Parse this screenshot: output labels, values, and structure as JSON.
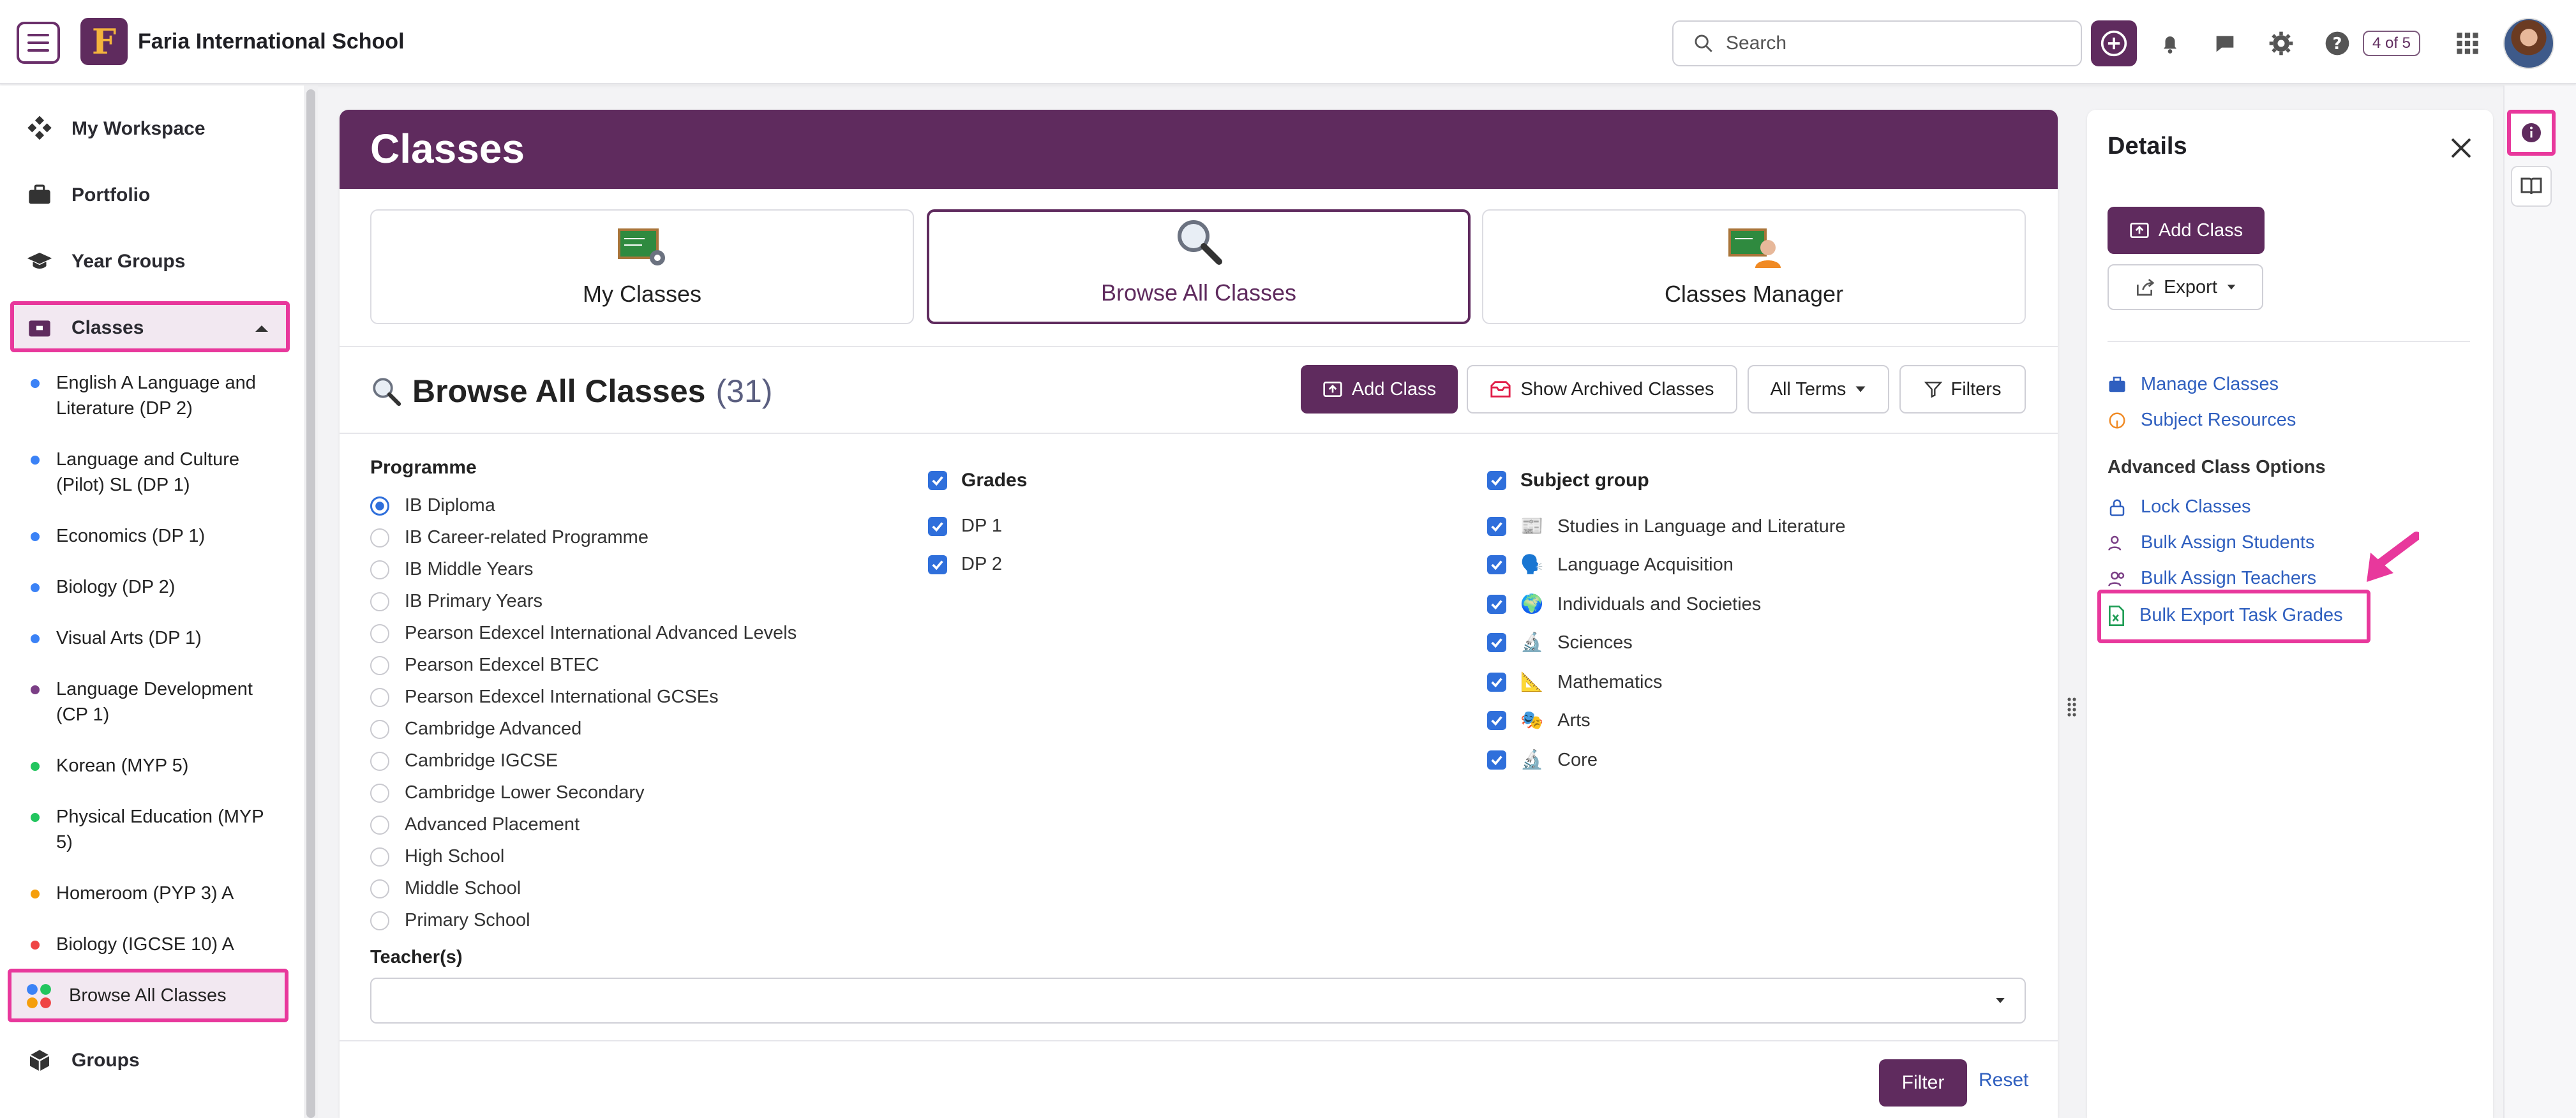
{
  "header": {
    "school_name": "Faria International School",
    "logo_letter": "F",
    "search_placeholder": "Search",
    "progress_badge": "4 of 5"
  },
  "sidebar": {
    "nav": [
      {
        "label": "My Workspace",
        "icon": "workspace-icon"
      },
      {
        "label": "Portfolio",
        "icon": "portfolio-icon"
      },
      {
        "label": "Year Groups",
        "icon": "graduation-cap-icon"
      },
      {
        "label": "Classes",
        "icon": "classes-icon"
      }
    ],
    "class_items": [
      {
        "label": "English A Language and Literature (DP 2)",
        "color": "#3b82f6"
      },
      {
        "label": "Language and Culture (Pilot) SL (DP 1)",
        "color": "#3b82f6"
      },
      {
        "label": "Economics (DP 1)",
        "color": "#3b82f6"
      },
      {
        "label": "Biology (DP 2)",
        "color": "#3b82f6"
      },
      {
        "label": "Visual Arts (DP 1)",
        "color": "#3b82f6"
      },
      {
        "label": "Language Development (CP 1)",
        "color": "#7b3f86"
      },
      {
        "label": "Korean (MYP 5)",
        "color": "#22c55e"
      },
      {
        "label": "Physical Education (MYP 5)",
        "color": "#22c55e"
      },
      {
        "label": "Homeroom (PYP 3) A",
        "color": "#f59e0b"
      },
      {
        "label": "Biology (IGCSE 10) A",
        "color": "#ef4444"
      }
    ],
    "browse_all": "Browse All Classes",
    "groups": "Groups"
  },
  "main": {
    "title": "Classes",
    "cards": [
      {
        "label": "My Classes"
      },
      {
        "label": "Browse All Classes"
      },
      {
        "label": "Classes Manager"
      }
    ],
    "browse_title": "Browse All Classes",
    "browse_count": "(31)",
    "toolbar": {
      "add_class": "Add Class",
      "show_archived": "Show Archived Classes",
      "all_terms": "All Terms",
      "filters": "Filters"
    },
    "programme": {
      "heading": "Programme",
      "selected": "IB Diploma",
      "options": [
        "IB Diploma",
        "IB Career-related Programme",
        "IB Middle Years",
        "IB Primary Years",
        "Pearson Edexcel International Advanced Levels",
        "Pearson Edexcel BTEC",
        "Pearson Edexcel International GCSEs",
        "Cambridge Advanced",
        "Cambridge IGCSE",
        "Cambridge Lower Secondary",
        "Advanced Placement",
        "High School",
        "Middle School",
        "Primary School"
      ]
    },
    "grades": {
      "heading": "Grades",
      "options": [
        "DP 1",
        "DP 2"
      ]
    },
    "subject_group": {
      "heading": "Subject group",
      "options": [
        {
          "label": "Studies in Language and Literature",
          "emoji": "📰"
        },
        {
          "label": "Language Acquisition",
          "emoji": "🗣️"
        },
        {
          "label": "Individuals and Societies",
          "emoji": "🌍"
        },
        {
          "label": "Sciences",
          "emoji": "🔬"
        },
        {
          "label": "Mathematics",
          "emoji": "📐"
        },
        {
          "label": "Arts",
          "emoji": "🎭"
        },
        {
          "label": "Core",
          "emoji": "🔬"
        }
      ]
    },
    "teachers_label": "Teacher(s)",
    "filter_button": "Filter",
    "reset_link": "Reset"
  },
  "details": {
    "title": "Details",
    "add_class": "Add Class",
    "export": "Export",
    "links": [
      "Manage Classes",
      "Subject Resources"
    ],
    "advanced_heading": "Advanced Class Options",
    "advanced_links": [
      "Lock Classes",
      "Bulk Assign Students",
      "Bulk Assign Teachers",
      "Bulk Export Task Grades"
    ]
  },
  "colors": {
    "brand": "#5f2b5e",
    "highlight": "#e8389c",
    "link": "#2f5fbf",
    "check": "#2f6fdb"
  }
}
